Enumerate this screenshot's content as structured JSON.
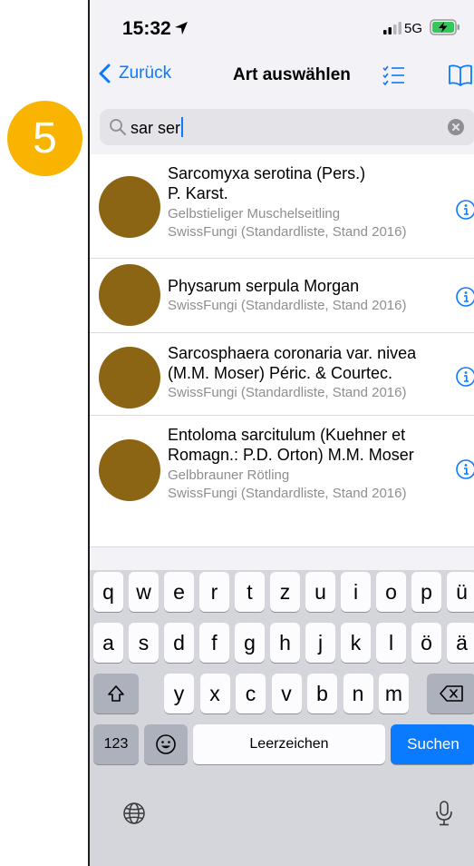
{
  "status_bar": {
    "time": "15:32",
    "network": "5G"
  },
  "nav": {
    "back_label": "Zurück",
    "title": "Art auswählen"
  },
  "search": {
    "value": "sar ser"
  },
  "results": [
    {
      "scientific_lines": [
        "Sarcomyxa serotina (Pers.)",
        "P. Karst."
      ],
      "common_name": "Gelbstieliger Muschelseitling",
      "source": "SwissFungi (Standardliste, Stand 2016)"
    },
    {
      "scientific_lines": [
        "Physarum serpula Morgan"
      ],
      "common_name": "",
      "source": "SwissFungi (Standardliste, Stand 2016)"
    },
    {
      "scientific_lines": [
        "Sarcosphaera coronaria var. nivea",
        "(M.M. Moser) Péric. & Courtec."
      ],
      "common_name": "",
      "source": "SwissFungi (Standardliste, Stand 2016)"
    },
    {
      "scientific_lines": [
        "Entoloma sarcitulum (Kuehner et",
        "Romagn.: P.D. Orton) M.M. Moser"
      ],
      "common_name": "Gelbbrauner Rötling",
      "source": "SwissFungi (Standardliste, Stand 2016)"
    }
  ],
  "keyboard": {
    "row1": [
      "q",
      "w",
      "e",
      "r",
      "t",
      "z",
      "u",
      "i",
      "o",
      "p",
      "ü"
    ],
    "row2": [
      "a",
      "s",
      "d",
      "f",
      "g",
      "h",
      "j",
      "k",
      "l",
      "ö",
      "ä"
    ],
    "row3": [
      "y",
      "x",
      "c",
      "v",
      "b",
      "n",
      "m"
    ],
    "numbers_label": "123",
    "space_label": "Leerzeichen",
    "action_label": "Suchen"
  },
  "step_badge": "5",
  "colors": {
    "accent": "#0a7aff",
    "avatar": "#8c6514",
    "badge": "#f8b400"
  }
}
